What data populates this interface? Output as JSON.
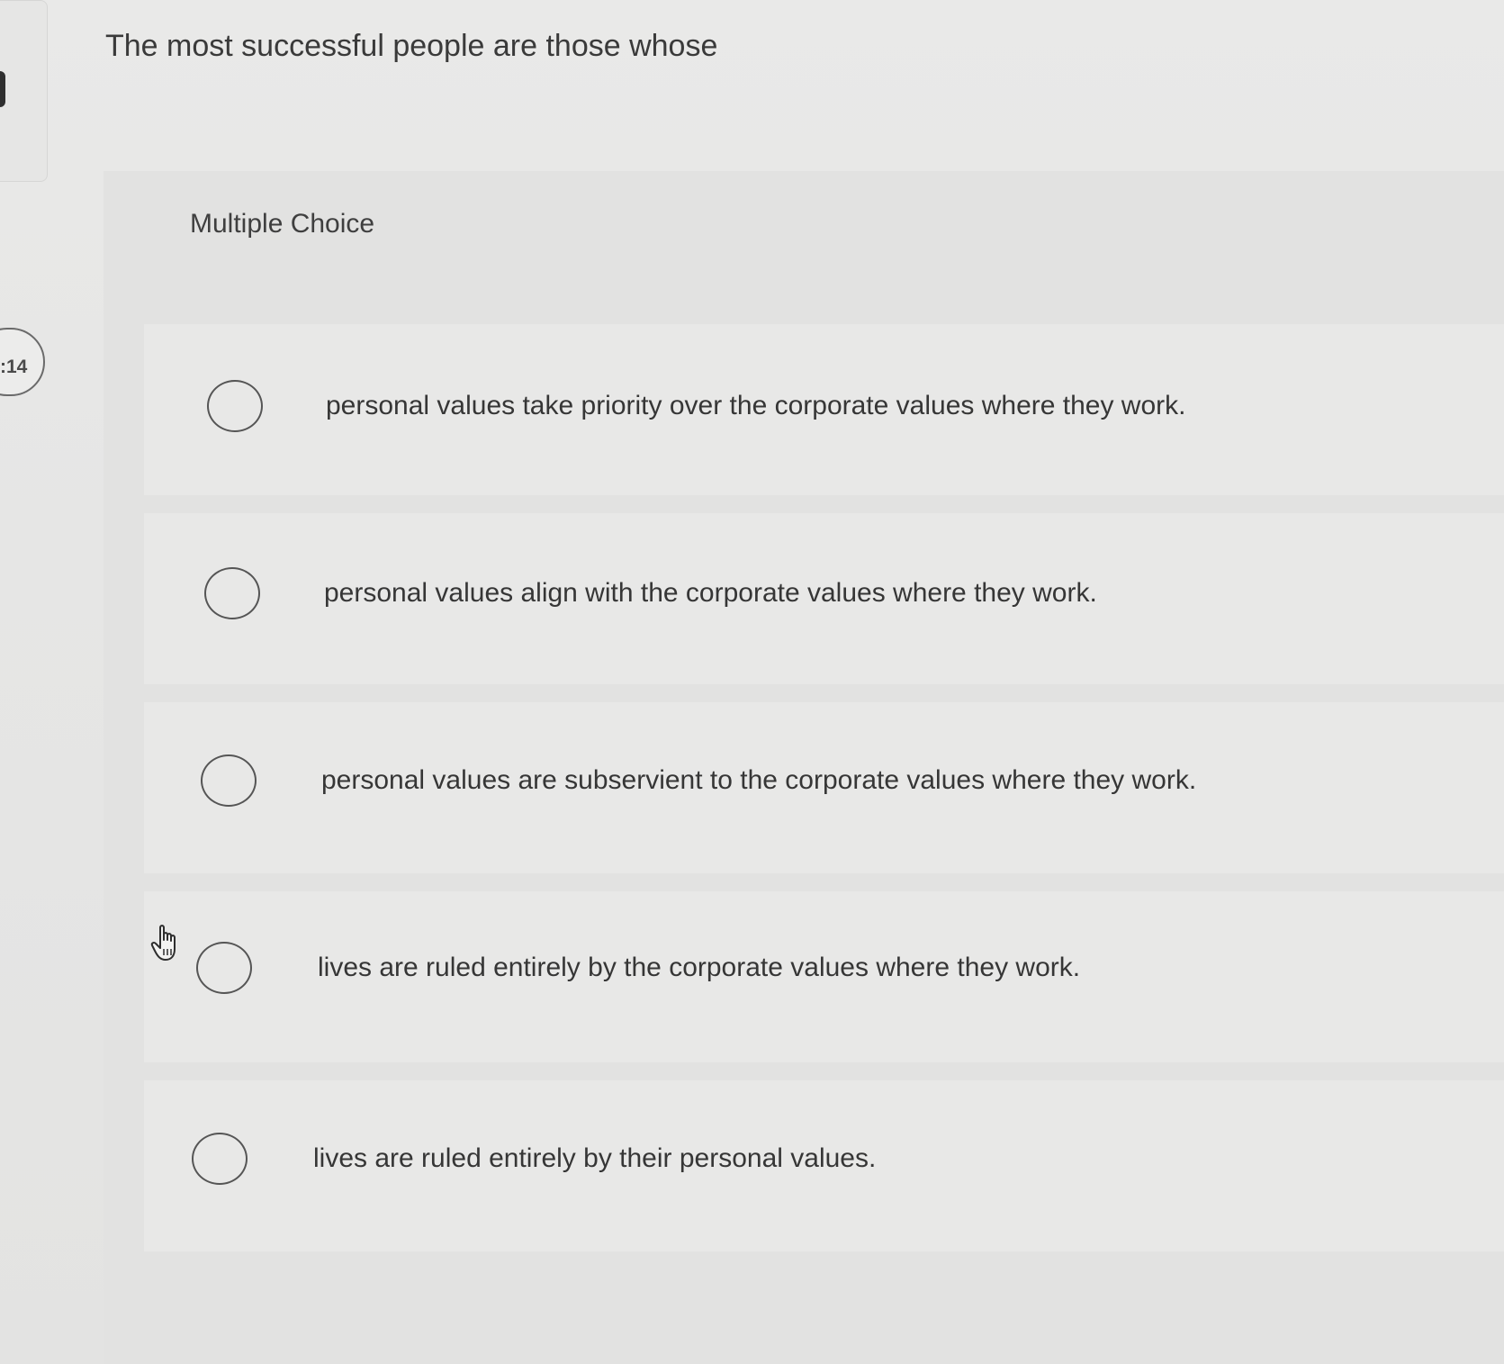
{
  "timer": {
    "text": ":14"
  },
  "question": {
    "text": "The most successful people are those whose"
  },
  "question_type": {
    "label": "Multiple Choice"
  },
  "options": [
    {
      "label": "personal values take priority over the corporate values where they work.",
      "selected": false
    },
    {
      "label": "personal values align with the corporate values where they work.",
      "selected": false
    },
    {
      "label": "personal values are subservient to the corporate values where they work.",
      "selected": false
    },
    {
      "label": "lives are ruled entirely by the corporate values where they work.",
      "selected": false
    },
    {
      "label": "lives are ruled entirely by their personal values.",
      "selected": false
    }
  ],
  "icons": {
    "cursor": "hand-pointer-icon",
    "radio": "radio-button-icon"
  },
  "colors": {
    "background": "#e7e7e6",
    "text": "#363636",
    "radio_border": "#555555"
  }
}
